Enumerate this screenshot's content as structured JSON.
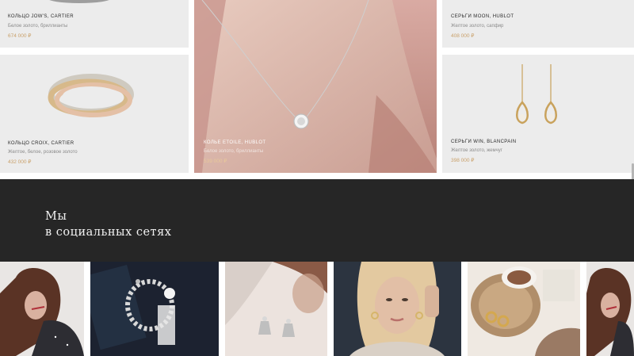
{
  "products": [
    {
      "name": "КОЛЬЦО JOW'S, CARTIER",
      "desc": "Белое золото, бриллианты",
      "price": "674 000 ₽"
    },
    {
      "name": "КОЛЬЦО CROIX, CARTIER",
      "desc": "Желтое, белое, розовое золото",
      "price": "432 000 ₽"
    },
    {
      "name": "КОЛЬЕ ETOILE, HUBLOT",
      "desc": "Белое золото, бриллианты",
      "price": "539 000 ₽"
    },
    {
      "name": "СЕРЬГИ MOON, HUBLOT",
      "desc": "Желтое золото, сапфир",
      "price": "408 000 ₽"
    },
    {
      "name": "СЕРЬГИ WIN, BLANCPAIN",
      "desc": "Желтое золото, жемчуг",
      "price": "398 000 ₽"
    }
  ],
  "social": {
    "title_line1": "Мы",
    "title_line2": "в социальных сетях"
  },
  "gallery": [
    {
      "icon": "woman-portrait-photo"
    },
    {
      "icon": "pearl-bracelet-photo"
    },
    {
      "icon": "silver-earrings-photo"
    },
    {
      "icon": "blonde-woman-photo"
    },
    {
      "icon": "coffee-earrings-photo"
    },
    {
      "icon": "woman-portrait-photo"
    }
  ],
  "colors": {
    "card_bg": "#ececec",
    "price": "#c9a06a",
    "social_bg": "#262626"
  }
}
